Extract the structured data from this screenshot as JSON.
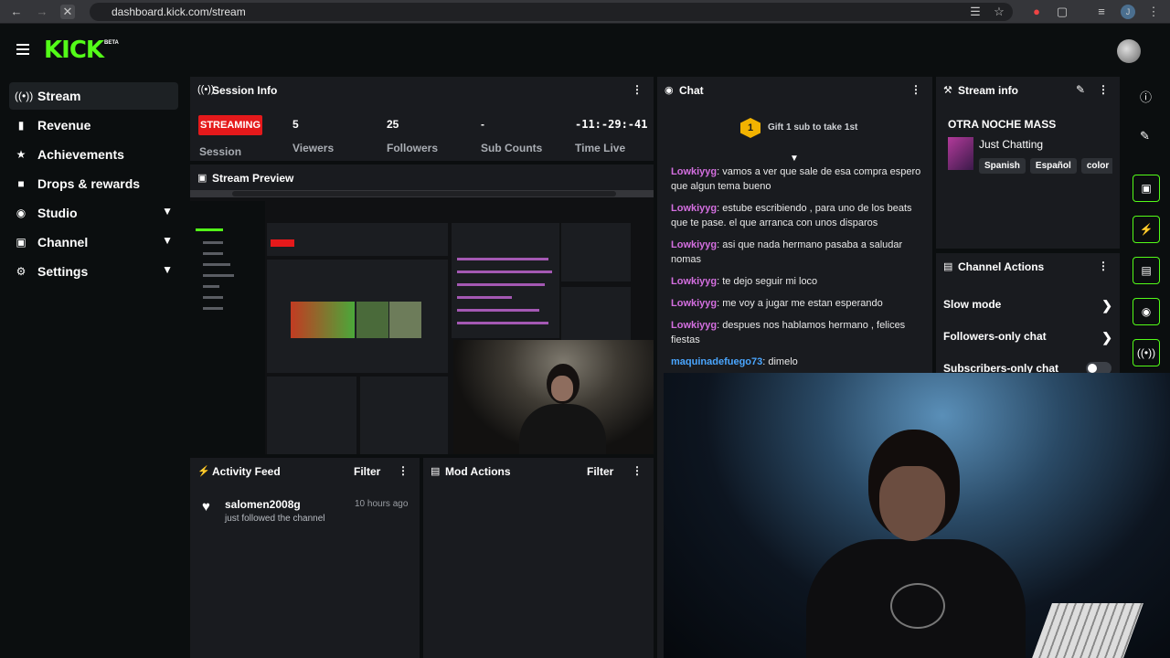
{
  "browser": {
    "url": "dashboard.kick.com/stream"
  },
  "header": {
    "logo": "KICK",
    "beta": "BETA"
  },
  "sidebar": {
    "items": [
      {
        "label": "Stream",
        "icon": "broadcast-icon"
      },
      {
        "label": "Revenue",
        "icon": "chart-icon"
      },
      {
        "label": "Achievements",
        "icon": "trophy-icon"
      },
      {
        "label": "Drops & rewards",
        "icon": "gift-icon"
      },
      {
        "label": "Studio",
        "icon": "camera-icon"
      },
      {
        "label": "Channel",
        "icon": "tv-icon"
      },
      {
        "label": "Settings",
        "icon": "gear-icon"
      }
    ]
  },
  "session": {
    "title": "Session Info",
    "status": "STREAMING",
    "status_label": "Session",
    "viewers": "5",
    "viewers_label": "Viewers",
    "followers": "25",
    "followers_label": "Followers",
    "subs": "-",
    "subs_label": "Sub Counts",
    "time": "-11:-29:-41",
    "time_label": "Time Live"
  },
  "preview": {
    "title": "Stream Preview"
  },
  "chat": {
    "title": "Chat",
    "gift": "Gift 1 sub to take 1st",
    "gift_rank": "1",
    "messages": [
      {
        "user": "Lowkiyyg",
        "text": ": vamos a ver que sale de esa compra espero que algun tema bueno"
      },
      {
        "user": "Lowkiyyg",
        "text": ": estube escribiendo , para uno de los beats que te pase. el que arranca con unos disparos"
      },
      {
        "user": "Lowkiyyg",
        "text": ": asi que nada hermano pasaba a saludar nomas"
      },
      {
        "user": "Lowkiyyg",
        "text": ": te dejo seguir mi loco"
      },
      {
        "user": "Lowkiyyg",
        "text": ": me voy a jugar me estan esperando"
      },
      {
        "user": "Lowkiyyg",
        "text": ": despues nos hablamos hermano , felices fiestas"
      },
      {
        "user": "maquinadefuego73",
        "text": ": dimelo"
      }
    ]
  },
  "stream_info": {
    "title": "Stream info",
    "stream_title": "OTRA NOCHE MASS",
    "category": "Just Chatting",
    "tags": [
      "Spanish",
      "Español",
      "color"
    ]
  },
  "channel_actions": {
    "title": "Channel Actions",
    "items": [
      "Slow mode",
      "Followers-only chat",
      "Subscribers-only chat"
    ]
  },
  "activity": {
    "title": "Activity Feed",
    "filter": "Filter",
    "user": "salomen2008g",
    "time": "10 hours ago",
    "action": "just followed the channel"
  },
  "mod": {
    "title": "Mod Actions",
    "filter": "Filter"
  },
  "colors": {
    "accent": "#53fc18",
    "streaming": "#e5191b",
    "panel": "#191b1f"
  }
}
